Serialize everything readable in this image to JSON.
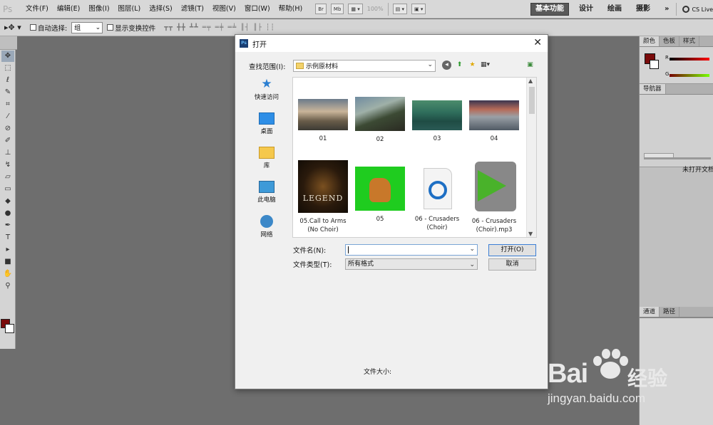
{
  "app": {
    "logo": "Ps",
    "menu": [
      "文件(F)",
      "编辑(E)",
      "图像(I)",
      "图层(L)",
      "选择(S)",
      "滤镜(T)",
      "视图(V)",
      "窗口(W)",
      "帮助(H)"
    ],
    "menubar_buttons": [
      "Br",
      "Mb"
    ],
    "zoom": "100%",
    "workspaces": [
      "基本功能",
      "设计",
      "绘画",
      "摄影"
    ],
    "more": "»",
    "cs_live": "CS Live"
  },
  "options": {
    "auto_select_label": "自动选择:",
    "auto_select_value": "组",
    "show_transform_label": "显示变换控件"
  },
  "right_panel": {
    "tabs": [
      "颜色",
      "色板",
      "样式"
    ],
    "r_label": "R",
    "g_label": "G",
    "navigator_tab": "导航器",
    "nav_note": "未打开文档",
    "layer_tabs": [
      "通道",
      "路径"
    ]
  },
  "dialog": {
    "title": "打开",
    "look_in_label": "查找范围(I):",
    "look_in_value": "示例原材料",
    "places": [
      "快速访问",
      "桌面",
      "库",
      "此电脑",
      "网络"
    ],
    "files": [
      {
        "name": "01"
      },
      {
        "name": "02"
      },
      {
        "name": "03"
      },
      {
        "name": "04"
      },
      {
        "name": "05.Call to Arms (No Choir)",
        "thumb_text": "LEGEND"
      },
      {
        "name": "05"
      },
      {
        "name": "06 - Crusaders (Choir)"
      },
      {
        "name": "06 - Crusaders (Choir).mp3"
      }
    ],
    "filename_label": "文件名(N):",
    "filename_value": "",
    "filetype_label": "文件类型(T):",
    "filetype_value": "所有格式",
    "open_button": "打开(O)",
    "cancel_button": "取消",
    "file_size_label": "文件大小:"
  },
  "watermark": {
    "brand": "Bai",
    "brand2": "经验",
    "url": "jingyan.baidu.com"
  }
}
